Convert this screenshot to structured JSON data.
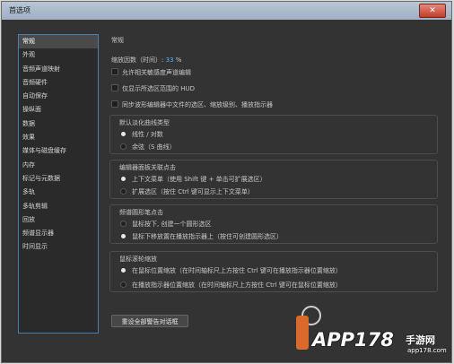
{
  "window": {
    "title": "首选项",
    "close_label": "✕"
  },
  "sidebar": {
    "items": [
      {
        "label": "常规",
        "active": true
      },
      {
        "label": "外观"
      },
      {
        "label": "音频声道映射"
      },
      {
        "label": "音频硬件"
      },
      {
        "label": "自动保存"
      },
      {
        "label": "操纵面"
      },
      {
        "label": "数据"
      },
      {
        "label": "效果"
      },
      {
        "label": "媒体与磁盘缓存"
      },
      {
        "label": "内存"
      },
      {
        "label": "标记与元数据"
      },
      {
        "label": "多轨"
      },
      {
        "label": "多轨剪辑"
      },
      {
        "label": "回放"
      },
      {
        "label": "频谱显示器"
      },
      {
        "label": "时间显示"
      }
    ]
  },
  "main": {
    "heading": "常规",
    "zoom": {
      "label": "缩放因数（时间）:",
      "value": "33",
      "unit": "%"
    },
    "checkboxes": [
      "允许相关敏感度声道编辑",
      "仅显示所选区范围的 HUD",
      "同步波形编辑器中文件的选区、缩放级别、播放指示器"
    ],
    "fade_group": {
      "title": "默认淡化曲线类型",
      "options": [
        "线性 / 对数",
        "余弦（S 曲线）"
      ],
      "selected": 0
    },
    "editor_panel_group": {
      "title": "编辑器面板关联点击",
      "options": [
        "上下文菜单（使用 Shift 键 + 单击可扩展选区）",
        "扩展选区（按住 Ctrl 键可显示上下文菜单）"
      ],
      "selected": 0
    },
    "spectral_pen_group": {
      "title": "频谱圆形笔点击",
      "options": [
        "鼠标按下, 创建一个圆形选区",
        "鼠标下移放置在播放指示器上（按住可创建圆形选区）"
      ],
      "selected": 1
    },
    "wheel_zoom_group": {
      "title": "鼠标滚轮缩放",
      "options": [
        "在鼠标位置缩放（在时间轴标尺上方按住 Ctrl 键可在播放指示器位置缩放）",
        "在播放指示器位置缩放（在时间轴标尺上方按住 Ctrl 键可在鼠标位置缩放）"
      ],
      "selected": 0
    },
    "reset_button": "重设全部警告对话框"
  },
  "watermark": {
    "brand": "APP178",
    "cn": "手游网",
    "url": "app178.com"
  },
  "colors": {
    "accent": "#4a7db0",
    "value": "#5fb3ff",
    "panel": "#333333"
  }
}
